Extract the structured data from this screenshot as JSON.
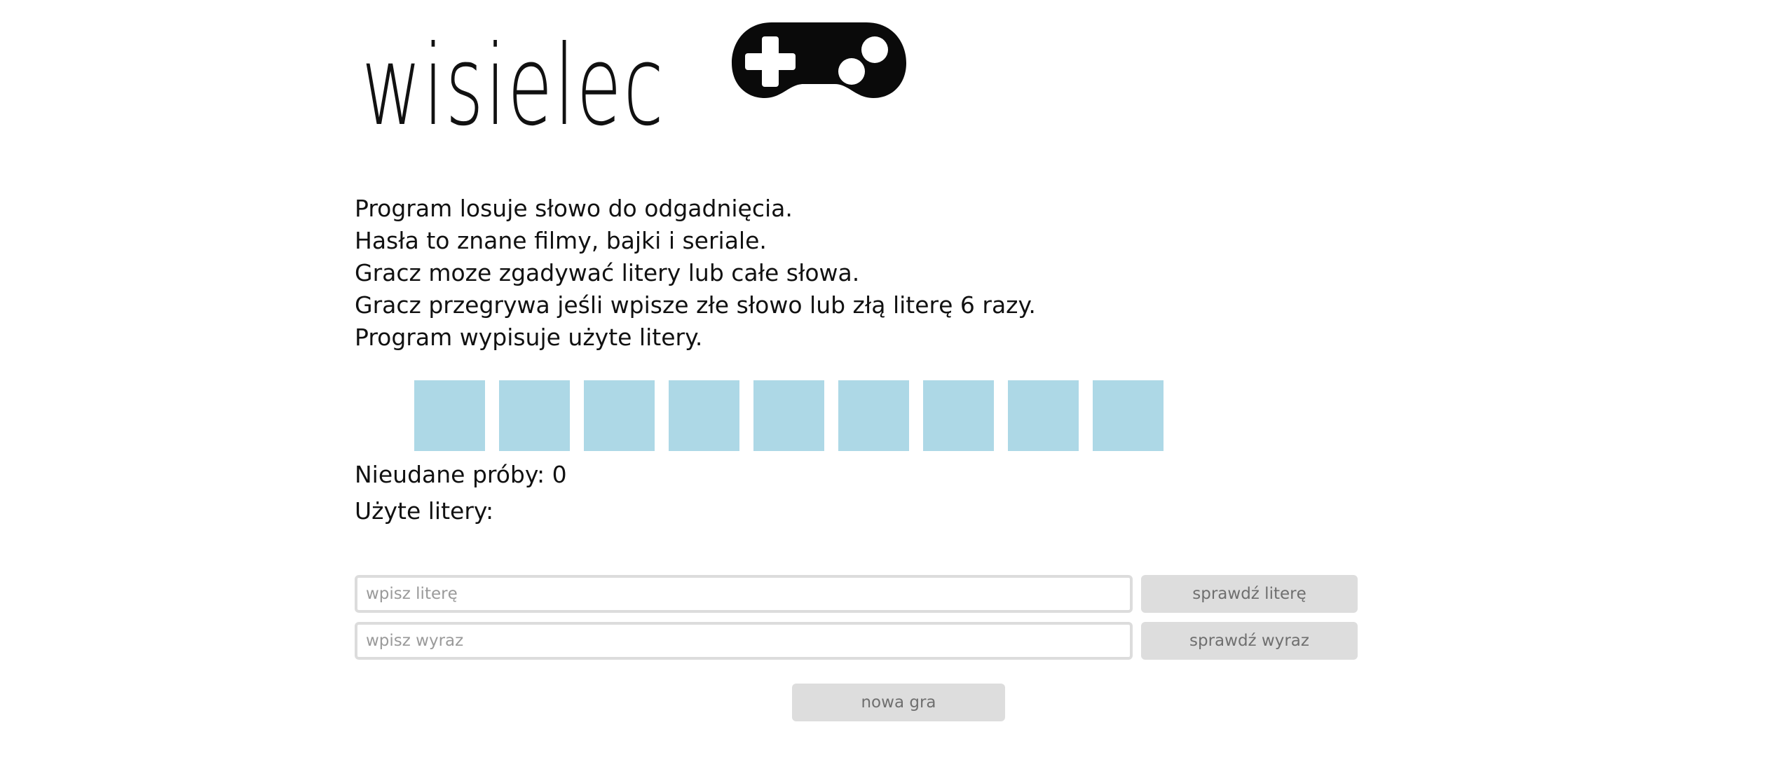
{
  "header": {
    "title": "wisielec",
    "icon": "gamepad-icon"
  },
  "rules": [
    "Program losuje słowo do odgadnięcia.",
    "Hasła to znane filmy, bajki i seriale.",
    "Gracz moze zgadywać litery lub całe słowa.",
    "Gracz przegrywa jeśli wpisze złe słowo lub złą literę 6 razy.",
    "Program wypisuje użyte litery."
  ],
  "board": {
    "tile_count": 9,
    "tile_color": "#add8e6"
  },
  "status": {
    "failed_attempts": "Nieudane próby: 0",
    "used_letters": "Użyte litery:"
  },
  "letter_input": {
    "placeholder": "wpisz literę",
    "value": "",
    "button": "sprawdź literę"
  },
  "word_input": {
    "placeholder": "wpisz wyraz",
    "value": "",
    "button": "sprawdź wyraz"
  },
  "new_game_button": "nowa gra"
}
